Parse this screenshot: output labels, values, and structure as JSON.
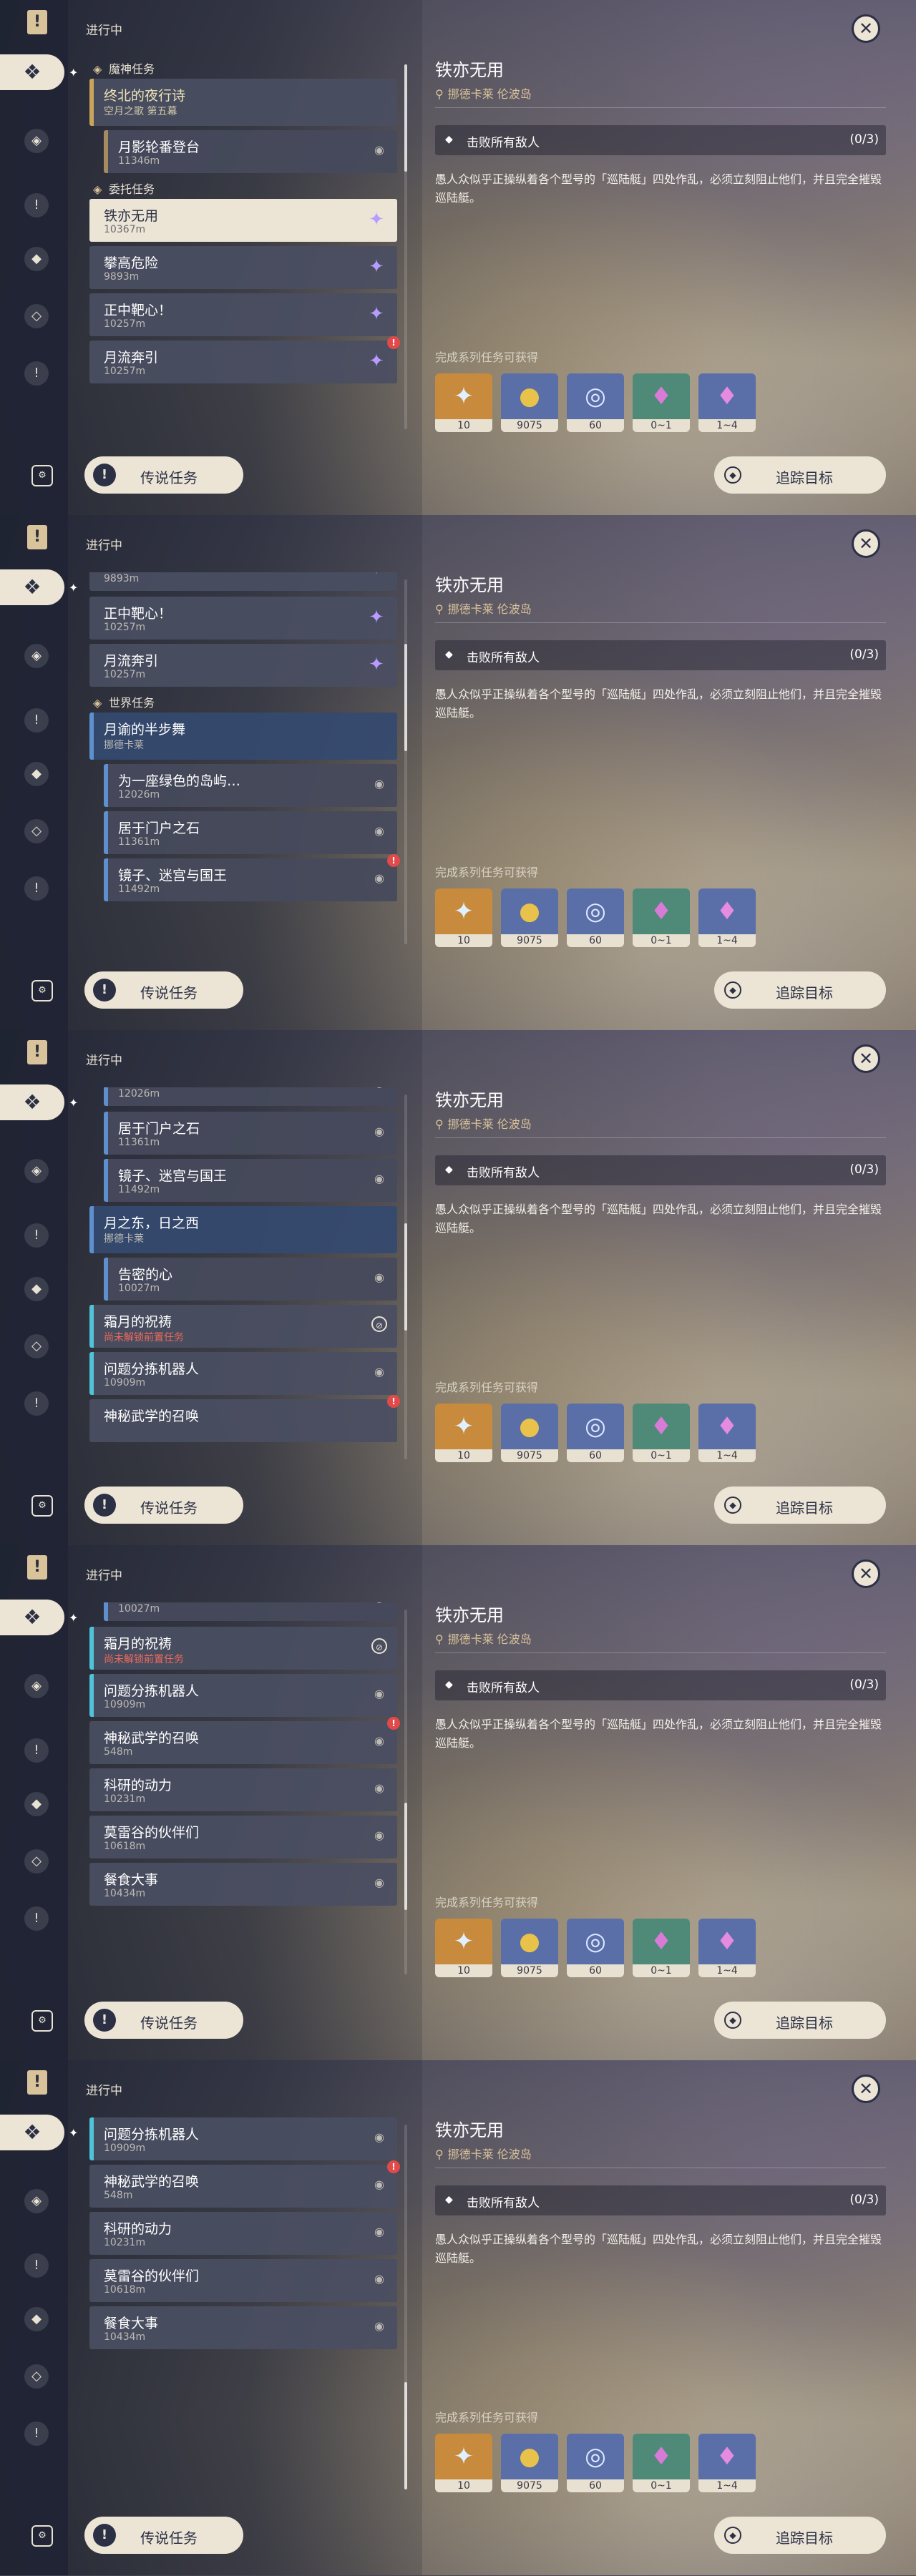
{
  "header": {
    "in_progress": "进行中"
  },
  "detail": {
    "title": "铁亦无用",
    "location": "挪德卡莱 伦波岛",
    "objective": "击败所有敌人",
    "objective_count": "(0/3)",
    "description": "愚人众似乎正操纵着各个型号的「巡陆艇」四处作乱，必须立刻阻止他们，并且完全摧毁巡陆艇。",
    "rewards_title": "完成系列任务可获得",
    "rewards": [
      {
        "icon": "adventure-exp-icon",
        "count": "10",
        "color": "#c88a3c"
      },
      {
        "icon": "mora-icon",
        "count": "9075",
        "color": "#5a6fa8"
      },
      {
        "icon": "companionship-exp-icon",
        "count": "60",
        "color": "#5a6fa8"
      },
      {
        "icon": "crystal-chunk-icon",
        "count": "0~1",
        "color": "#4f8a78"
      },
      {
        "icon": "crystal-cluster-icon",
        "count": "1~4",
        "color": "#5a6fa8"
      }
    ]
  },
  "buttons": {
    "legend": "传说任务",
    "track": "追踪目标"
  },
  "panels": [
    {
      "thumb_frac": 0.0,
      "items": [
        {
          "kind": "section",
          "label": "魔神任务"
        },
        {
          "kind": "quest",
          "style": "gold",
          "title": "终北的夜行诗",
          "sub": "空月之歌 第五幕"
        },
        {
          "kind": "quest",
          "style": "sub",
          "title": "月影轮番登台",
          "sub": "11346m",
          "tail": "pin"
        },
        {
          "kind": "section",
          "label": "委托任务"
        },
        {
          "kind": "quest",
          "style": "selected",
          "title": "铁亦无用",
          "sub": "10367m",
          "tail": "glyph"
        },
        {
          "kind": "quest",
          "style": "neutral",
          "title": "攀高危险",
          "sub": "9893m",
          "tail": "glyph"
        },
        {
          "kind": "quest",
          "style": "neutral",
          "title": "正中靶心！",
          "sub": "10257m",
          "tail": "glyph"
        },
        {
          "kind": "quest",
          "style": "neutral",
          "title": "月流奔引",
          "sub": "10257m",
          "tail": "glyph",
          "marker": true
        }
      ]
    },
    {
      "thumb_frac": 0.25,
      "items": [
        {
          "kind": "quest",
          "style": "neutral",
          "title": "",
          "sub": "9893m",
          "tail": "glyph",
          "partial": true
        },
        {
          "kind": "quest",
          "style": "neutral",
          "title": "正中靶心！",
          "sub": "10257m",
          "tail": "glyph"
        },
        {
          "kind": "quest",
          "style": "neutral",
          "title": "月流奔引",
          "sub": "10257m",
          "tail": "glyph"
        },
        {
          "kind": "section",
          "label": "世界任务"
        },
        {
          "kind": "quest",
          "style": "blue",
          "title": "月谕的半步舞",
          "sub": "挪德卡莱"
        },
        {
          "kind": "quest",
          "style": "sub blueb",
          "title": "为一座绿色的岛屿…",
          "sub": "12026m",
          "tail": "pin"
        },
        {
          "kind": "quest",
          "style": "sub blueb",
          "title": "居于门户之石",
          "sub": "11361m",
          "tail": "pin"
        },
        {
          "kind": "quest",
          "style": "sub blueb",
          "title": "镜子、迷宫与国王",
          "sub": "11492m",
          "tail": "pin",
          "marker": true
        }
      ]
    },
    {
      "thumb_frac": 0.5,
      "items": [
        {
          "kind": "quest",
          "style": "sub blueb",
          "title": "为一座绿色的岛屿…",
          "sub": "12026m",
          "tail": "pin",
          "partial": true
        },
        {
          "kind": "quest",
          "style": "sub blueb",
          "title": "居于门户之石",
          "sub": "11361m",
          "tail": "pin"
        },
        {
          "kind": "quest",
          "style": "sub blueb",
          "title": "镜子、迷宫与国王",
          "sub": "11492m",
          "tail": "pin"
        },
        {
          "kind": "quest",
          "style": "blue",
          "title": "月之东，日之西",
          "sub": "挪德卡莱"
        },
        {
          "kind": "quest",
          "style": "sub blueb",
          "title": "告密的心",
          "sub": "10027m",
          "tail": "pin"
        },
        {
          "kind": "quest",
          "style": "teal",
          "title": "霜月的祝祷",
          "sub": "尚未解锁前置任务",
          "warn": true,
          "tail": "ban"
        },
        {
          "kind": "quest",
          "style": "teal",
          "title": "问题分拣机器人",
          "sub": "10909m",
          "tail": "pin"
        },
        {
          "kind": "quest",
          "style": "neutral",
          "title": "神秘武学的召唤",
          "sub": "",
          "marker": true
        }
      ]
    },
    {
      "thumb_frac": 0.75,
      "items": [
        {
          "kind": "quest",
          "style": "sub blueb",
          "title": "告密的心",
          "sub": "10027m",
          "tail": "pin",
          "partial": true
        },
        {
          "kind": "quest",
          "style": "teal",
          "title": "霜月的祝祷",
          "sub": "尚未解锁前置任务",
          "warn": true,
          "tail": "ban"
        },
        {
          "kind": "quest",
          "style": "teal",
          "title": "问题分拣机器人",
          "sub": "10909m",
          "tail": "pin"
        },
        {
          "kind": "quest",
          "style": "neutral",
          "title": "神秘武学的召唤",
          "sub": "548m",
          "tail": "pin",
          "marker": true
        },
        {
          "kind": "quest",
          "style": "neutral",
          "title": "科研的动力",
          "sub": "10231m",
          "tail": "pin"
        },
        {
          "kind": "quest",
          "style": "neutral",
          "title": "莫雷谷的伙伴们",
          "sub": "10618m",
          "tail": "pin"
        },
        {
          "kind": "quest",
          "style": "neutral",
          "title": "餐食大事",
          "sub": "10434m",
          "tail": "pin"
        }
      ]
    },
    {
      "thumb_frac": 1.0,
      "items": [
        {
          "kind": "quest",
          "style": "teal",
          "title": "问题分拣机器人",
          "sub": "10909m",
          "tail": "pin"
        },
        {
          "kind": "quest",
          "style": "neutral",
          "title": "神秘武学的召唤",
          "sub": "548m",
          "tail": "pin",
          "marker": true
        },
        {
          "kind": "quest",
          "style": "neutral",
          "title": "科研的动力",
          "sub": "10231m",
          "tail": "pin"
        },
        {
          "kind": "quest",
          "style": "neutral",
          "title": "莫雷谷的伙伴们",
          "sub": "10618m",
          "tail": "pin"
        },
        {
          "kind": "quest",
          "style": "neutral",
          "title": "餐食大事",
          "sub": "10434m",
          "tail": "pin"
        }
      ]
    }
  ],
  "rail_icons": [
    "quest-log-icon",
    "archon-quest-icon",
    "story-quest-icon",
    "commission-quest-icon",
    "world-quest-icon",
    "legend-quest-icon",
    "settings-icon"
  ],
  "glyphs": {
    "pin": "◉",
    "glyph": "✦",
    "ban": "⊘",
    "marker": "!"
  }
}
